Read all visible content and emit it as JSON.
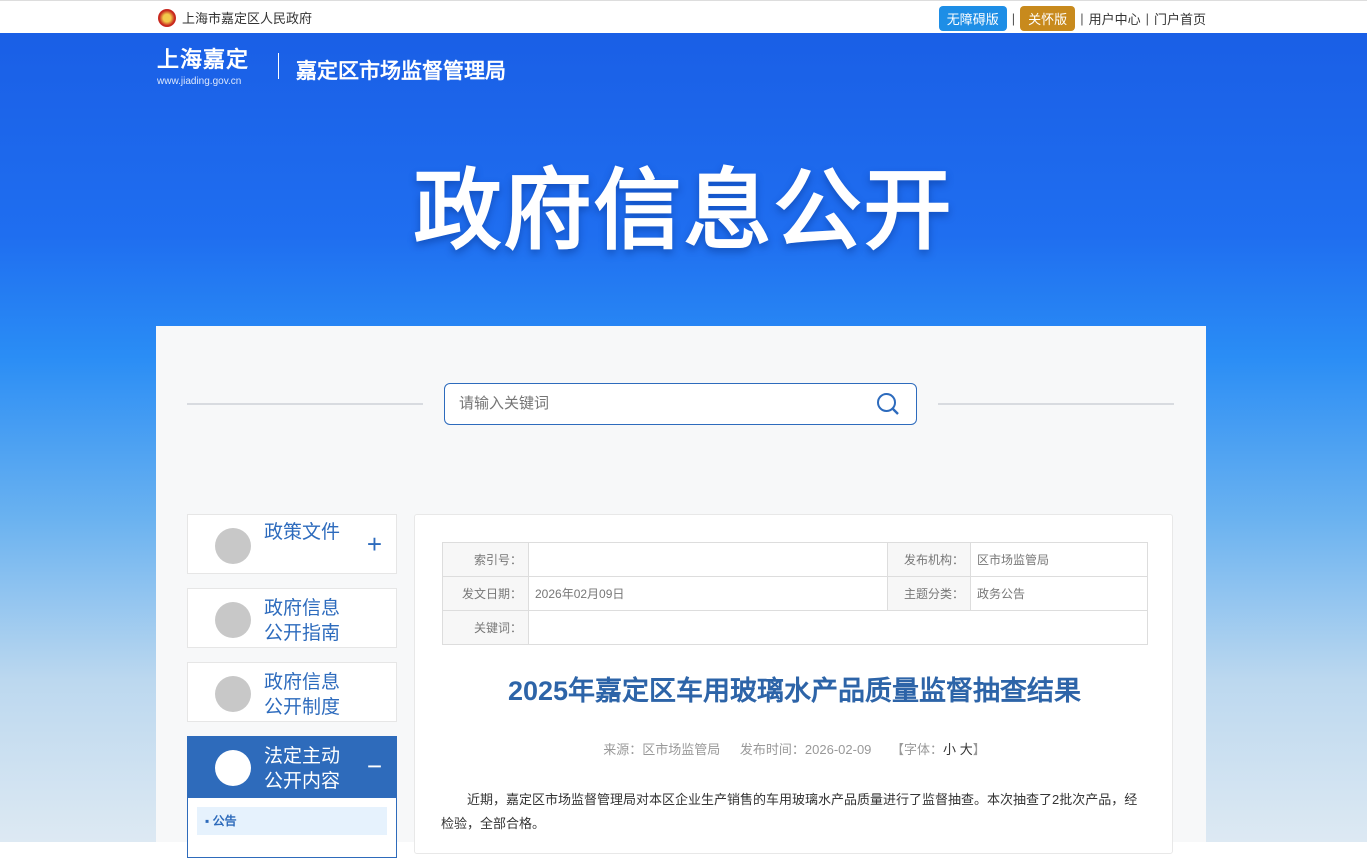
{
  "topbar": {
    "gov_name": "上海市嘉定区人民政府",
    "accessible_label": "无障碍版",
    "care_label": "关怀版",
    "user_center": "用户中心",
    "portal_home": "门户首页",
    "separator": "|",
    "accessible_color": "#1e8ee6",
    "care_color": "#c88a1d"
  },
  "header": {
    "logo_text": "上海嘉定",
    "logo_url": "www.jiading.gov.cn",
    "bureau": "嘉定区市场监督管理局",
    "hero_title": "政府信息公开"
  },
  "search": {
    "placeholder": "请输入关键词"
  },
  "sidebar": {
    "items": [
      {
        "label": "政策文件",
        "toggle": "+"
      },
      {
        "label": "政府信息公开指南"
      },
      {
        "label": "政府信息公开制度"
      },
      {
        "label": "法定主动公开内容",
        "toggle": "−",
        "expanded": true,
        "children": [
          {
            "label": "公告"
          }
        ]
      }
    ]
  },
  "info_table": {
    "index_label": "索引号：",
    "index_value": "",
    "publisher_label": "发布机构：",
    "publisher_value": "区市场监管局",
    "date_label": "发文日期：",
    "date_value": "2026年02月09日",
    "topic_label": "主题分类：",
    "topic_value": "政务公告",
    "keywords_label": "关键词：",
    "keywords_value": ""
  },
  "article": {
    "title": "2025年嘉定区车用玻璃水产品质量监督抽查结果",
    "source": "来源：区市场监管局",
    "publish_time": "发布时间：2026-02-09",
    "font_label": "【字体：",
    "font_small": "小",
    "font_large": "大",
    "font_close": "】",
    "body": "近期，嘉定区市场监督管理局对本区企业生产销售的车用玻璃水产品质量进行了监督抽查。本次抽查了2批次产品，经检验，全部合格。"
  }
}
